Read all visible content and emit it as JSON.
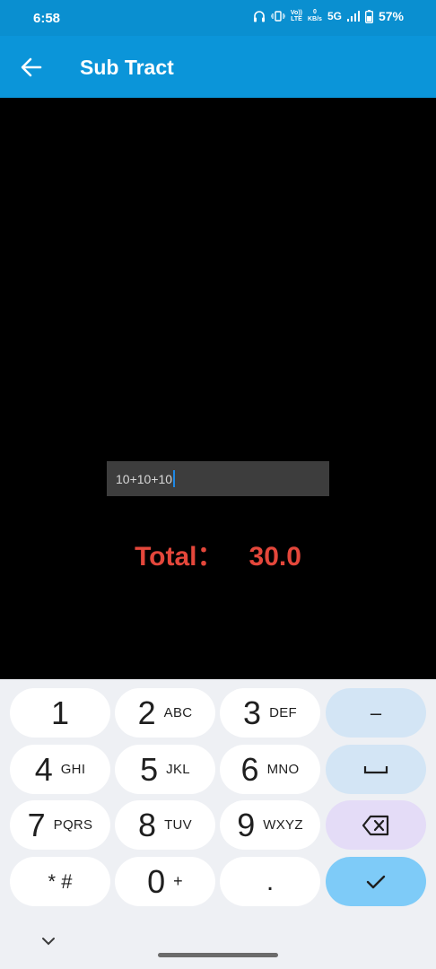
{
  "status_bar": {
    "time": "6:58",
    "volte_line1": "Vo))",
    "volte_line2": "LTE",
    "speed_value": "0",
    "speed_unit": "KB/s",
    "network": "5G",
    "battery": "57%"
  },
  "app_bar": {
    "title": "Sub Tract",
    "back_icon": "arrow-left-icon"
  },
  "expression": {
    "value": "10+10+10"
  },
  "total": {
    "label": "Total：",
    "value": "30.0"
  },
  "keyboard": {
    "rows": [
      [
        {
          "main": "1",
          "sub": ""
        },
        {
          "main": "2",
          "sub": "ABC"
        },
        {
          "main": "3",
          "sub": "DEF"
        },
        {
          "main": "–",
          "sub": ""
        }
      ],
      [
        {
          "main": "4",
          "sub": "GHI"
        },
        {
          "main": "5",
          "sub": "JKL"
        },
        {
          "main": "6",
          "sub": "MNO"
        },
        {
          "main": "space",
          "sub": ""
        }
      ],
      [
        {
          "main": "7",
          "sub": "PQRS"
        },
        {
          "main": "8",
          "sub": "TUV"
        },
        {
          "main": "9",
          "sub": "WXYZ"
        },
        {
          "main": "backspace",
          "sub": ""
        }
      ],
      [
        {
          "main": "* #",
          "sub": ""
        },
        {
          "main": "0",
          "sub": "+"
        },
        {
          "main": ".",
          "sub": ""
        },
        {
          "main": "done",
          "sub": ""
        }
      ]
    ],
    "colors": {
      "key": "#ffffff",
      "special": "#d3e5f5",
      "backspace": "#e4dcf7",
      "confirm": "#7ecbf8",
      "background": "#eef0f4"
    }
  },
  "colors": {
    "app_bar": "#0b95d9",
    "total_text": "#e4473b",
    "input_bg": "#3d3d3d"
  }
}
